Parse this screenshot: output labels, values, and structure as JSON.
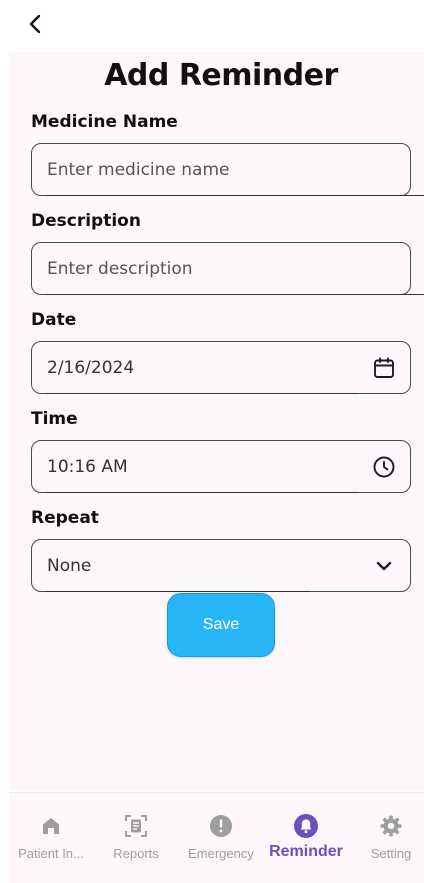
{
  "header": {
    "back_icon": "chevron-left-icon"
  },
  "page": {
    "title": "Add Reminder"
  },
  "form": {
    "medicine_name": {
      "label": "Medicine Name",
      "placeholder": "Enter medicine name",
      "value": ""
    },
    "description": {
      "label": "Description",
      "placeholder": "Enter description",
      "value": ""
    },
    "date": {
      "label": "Date",
      "value": "2/16/2024",
      "icon": "calendar-icon"
    },
    "time": {
      "label": "Time",
      "value": "10:16 AM",
      "icon": "clock-icon"
    },
    "repeat": {
      "label": "Repeat",
      "value": "None",
      "icon": "chevron-down-icon"
    },
    "save_label": "Save"
  },
  "bottom_nav": {
    "items": [
      {
        "label": "Patient In...",
        "icon": "home-icon",
        "active": false
      },
      {
        "label": "Reports",
        "icon": "document-scan-icon",
        "active": false
      },
      {
        "label": "Emergency",
        "icon": "alert-icon",
        "active": false
      },
      {
        "label": "Reminder",
        "icon": "bell-icon",
        "active": true
      },
      {
        "label": "Setting",
        "icon": "gear-icon",
        "active": false
      }
    ]
  },
  "colors": {
    "accent": "#6a4fbf",
    "save_button": "#29b6f6",
    "background": "#fdf7fb",
    "inactive_nav": "#9e9e9e"
  }
}
